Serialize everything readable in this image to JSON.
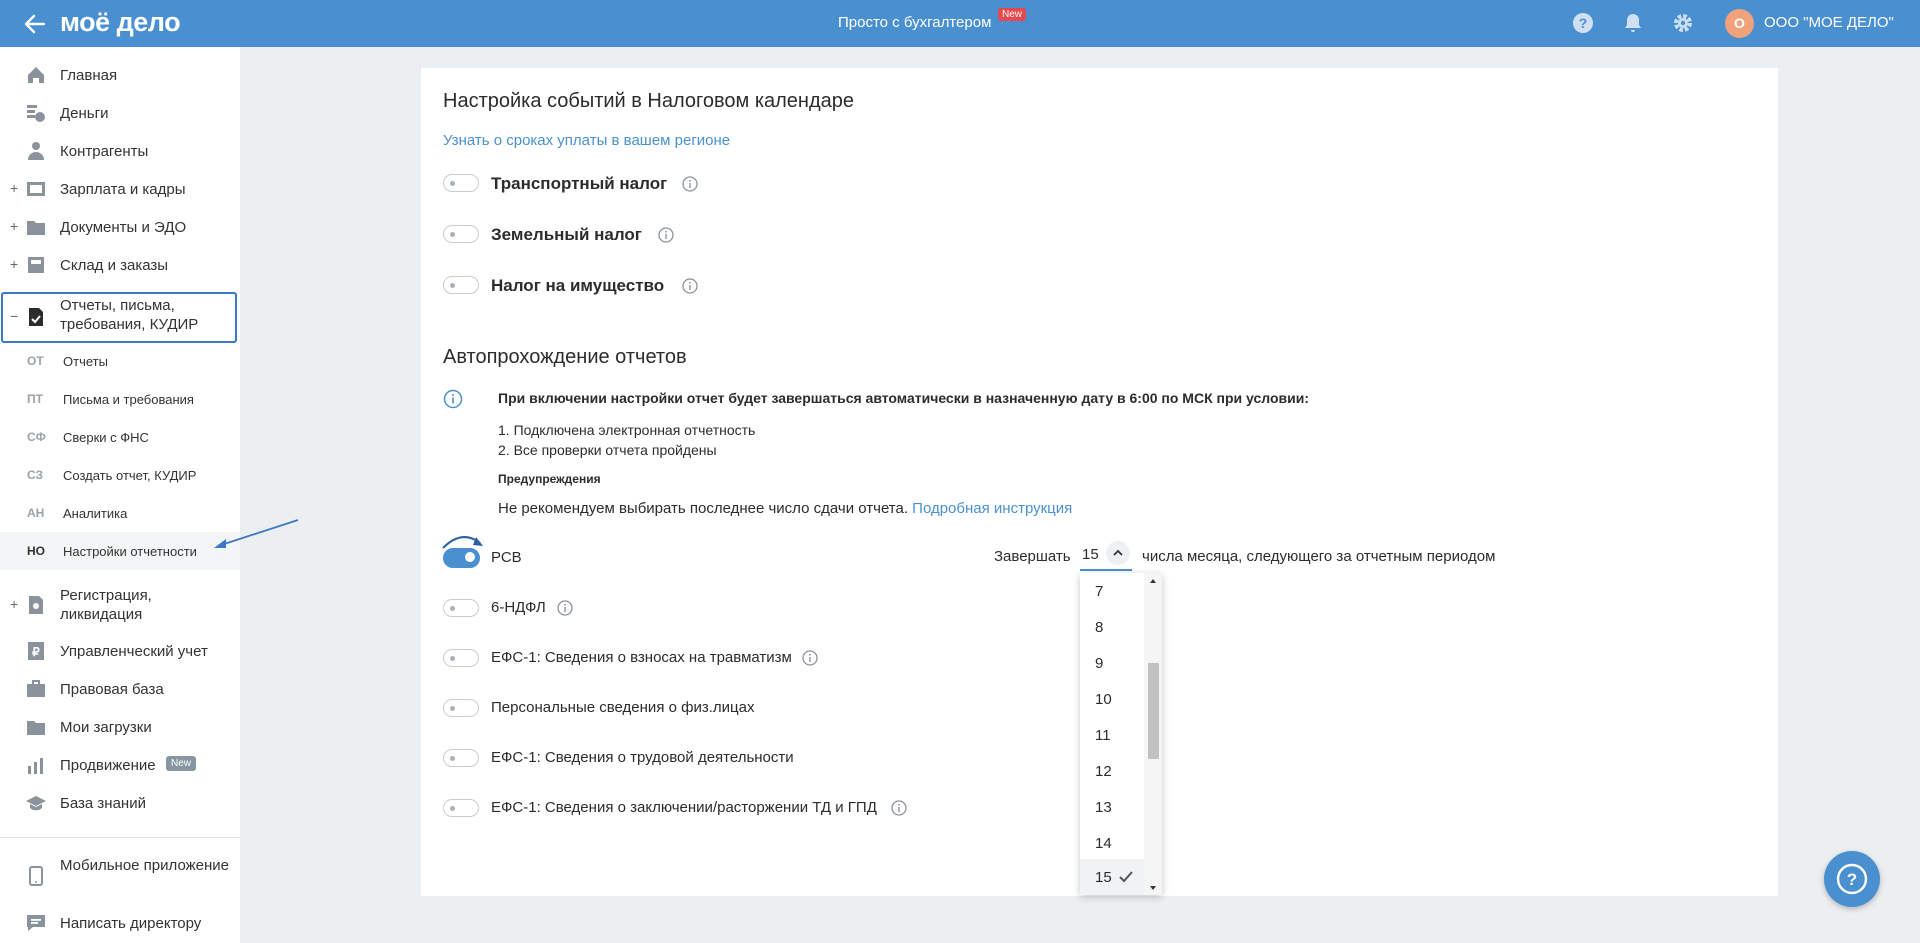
{
  "header": {
    "logo": "моё дело",
    "tagline": "Просто с бухгалтером",
    "tagline_badge": "New",
    "avatar_letter": "О",
    "company": "ООО \"МОЕ ДЕЛО\""
  },
  "sidebar": {
    "items": [
      {
        "label": "Главная",
        "icon": "home-icon"
      },
      {
        "label": "Деньги",
        "icon": "money-icon"
      },
      {
        "label": "Контрагенты",
        "icon": "contractors-icon"
      },
      {
        "label": "Зарплата и кадры",
        "icon": "salary-icon",
        "expand": "+"
      },
      {
        "label": "Документы и ЭДО",
        "icon": "folder-icon",
        "expand": "+"
      },
      {
        "label": "Склад и заказы",
        "icon": "warehouse-icon",
        "expand": "+"
      },
      {
        "label": "Отчеты, письма, требования, КУДИР",
        "icon": "report-icon",
        "expand": "−"
      },
      {
        "label": "Регистрация, ликвидация",
        "icon": "registration-icon",
        "expand": "+"
      },
      {
        "label": "Управленческий учет",
        "icon": "accounting-icon"
      },
      {
        "label": "Правовая база",
        "icon": "briefcase-icon"
      },
      {
        "label": "Мои загрузки",
        "icon": "downloads-icon"
      },
      {
        "label": "Продвижение",
        "icon": "promotion-icon",
        "badge": "New"
      },
      {
        "label": "База знаний",
        "icon": "knowledge-icon"
      }
    ],
    "subitems": [
      {
        "abbr": "ОТ",
        "label": "Отчеты"
      },
      {
        "abbr": "ПТ",
        "label": "Письма и требования"
      },
      {
        "abbr": "СФ",
        "label": "Сверки с ФНС"
      },
      {
        "abbr": "СЗ",
        "label": "Создать отчет, КУДИР"
      },
      {
        "abbr": "АН",
        "label": "Аналитика"
      },
      {
        "abbr": "НО",
        "label": "Настройки отчетности"
      }
    ],
    "bottom": [
      {
        "label": "Мобильное приложение",
        "icon": "mobile-icon"
      },
      {
        "label": "Написать директору",
        "icon": "message-icon"
      }
    ]
  },
  "main": {
    "calendar_title": "Настройка событий в Налоговом календаре",
    "region_link": "Узнать о сроках уплаты в вашем регионе",
    "taxes": [
      {
        "label": "Транспортный налог",
        "enabled": false
      },
      {
        "label": "Земельный налог",
        "enabled": false
      },
      {
        "label": "Налог на имущество",
        "enabled": false
      }
    ],
    "auto_title": "Автопрохождение отчетов",
    "note_bold": "При включении настройки отчет будет завершаться автоматически в назначенную дату в 6:00 по МСК при условии:",
    "note_lines": [
      "1. Подключена электронная отчетность",
      "2. Все проверки отчета пройдены"
    ],
    "warn_title": "Предупреждения",
    "warn_text": "Не рекомендуем выбирать последнее число сдачи отчета.",
    "warn_link": "Подробная инструкция",
    "reports": [
      {
        "label": "РСВ",
        "enabled": true
      },
      {
        "label": "6-НДФЛ",
        "enabled": false
      },
      {
        "label": "ЕФС-1: Сведения о взносах на травматизм",
        "enabled": false
      },
      {
        "label": "Персональные сведения о физ.лицах",
        "enabled": false
      },
      {
        "label": "ЕФС-1: Сведения о трудовой деятельности",
        "enabled": false
      },
      {
        "label": "ЕФС-1: Сведения о заключении/расторжении ТД и ГПД",
        "enabled": false
      }
    ],
    "finish_label": "Завершать",
    "finish_value": "15",
    "after_label": "числа месяца, следующего за отчетным периодом",
    "options": [
      "7",
      "8",
      "9",
      "10",
      "11",
      "12",
      "13",
      "14",
      "15"
    ],
    "selected_option": "15"
  },
  "colors": {
    "accent": "#4a90d0",
    "header": "#4a90d0",
    "badge": "#e5484d"
  }
}
